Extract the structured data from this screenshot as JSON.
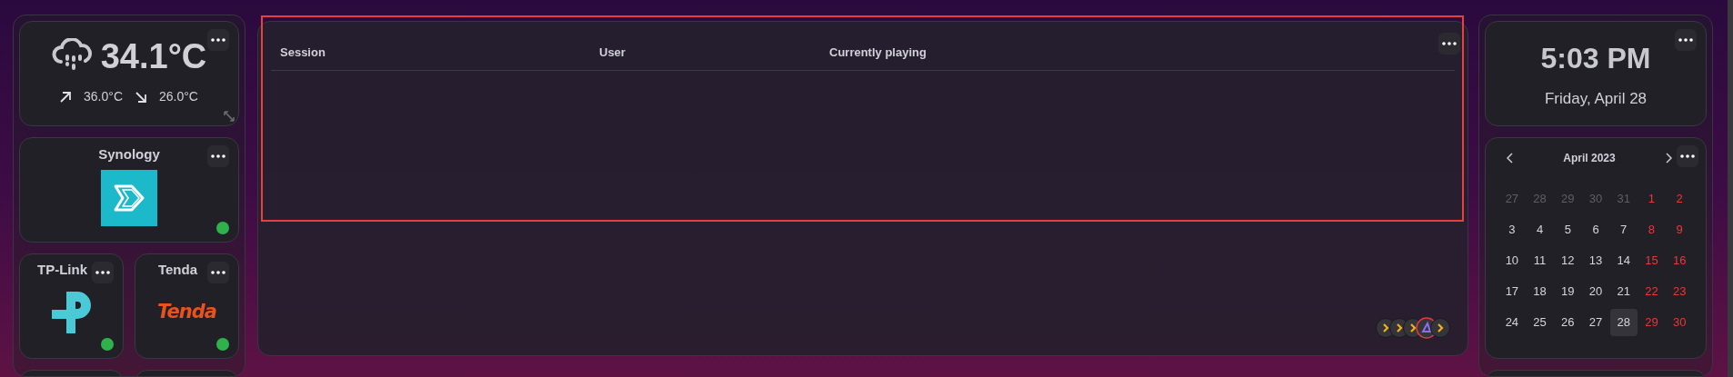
{
  "weather": {
    "temperature": "34.1°C",
    "high": "36.0°C",
    "low": "26.0°C"
  },
  "apps": [
    {
      "name": "Synology",
      "kind": "synology",
      "online": true
    },
    {
      "name": "TP-Link",
      "kind": "tplink",
      "online": true
    },
    {
      "name": "Tenda",
      "kind": "tenda",
      "logo_text": "Tenda",
      "online": true
    }
  ],
  "sessions": {
    "columns": [
      "Session",
      "User",
      "Currently playing"
    ],
    "avatars": [
      {
        "kind": "chevron"
      },
      {
        "kind": "chevron"
      },
      {
        "kind": "chevron"
      },
      {
        "kind": "ring"
      },
      {
        "kind": "chevron"
      }
    ]
  },
  "clock": {
    "time": "5:03 PM",
    "date": "Friday, April 28"
  },
  "calendar": {
    "month": "April 2023",
    "days": [
      {
        "label": "27",
        "kind": "outside",
        "selected": false
      },
      {
        "label": "28",
        "kind": "outside",
        "selected": false
      },
      {
        "label": "29",
        "kind": "outside",
        "selected": false
      },
      {
        "label": "30",
        "kind": "outside",
        "selected": false
      },
      {
        "label": "31",
        "kind": "outside",
        "selected": false
      },
      {
        "label": "1",
        "kind": "weekend",
        "selected": false
      },
      {
        "label": "2",
        "kind": "weekend",
        "selected": false
      },
      {
        "label": "3",
        "kind": "weekday",
        "selected": false
      },
      {
        "label": "4",
        "kind": "weekday",
        "selected": false
      },
      {
        "label": "5",
        "kind": "weekday",
        "selected": false
      },
      {
        "label": "6",
        "kind": "weekday",
        "selected": false
      },
      {
        "label": "7",
        "kind": "weekday",
        "selected": false
      },
      {
        "label": "8",
        "kind": "weekend",
        "selected": false
      },
      {
        "label": "9",
        "kind": "weekend",
        "selected": false
      },
      {
        "label": "10",
        "kind": "weekday",
        "selected": false
      },
      {
        "label": "11",
        "kind": "weekday",
        "selected": false
      },
      {
        "label": "12",
        "kind": "weekday",
        "selected": false
      },
      {
        "label": "13",
        "kind": "weekday",
        "selected": false
      },
      {
        "label": "14",
        "kind": "weekday",
        "selected": false
      },
      {
        "label": "15",
        "kind": "weekend",
        "selected": false
      },
      {
        "label": "16",
        "kind": "weekend",
        "selected": false
      },
      {
        "label": "17",
        "kind": "weekday",
        "selected": false
      },
      {
        "label": "18",
        "kind": "weekday",
        "selected": false
      },
      {
        "label": "19",
        "kind": "weekday",
        "selected": false
      },
      {
        "label": "20",
        "kind": "weekday",
        "selected": false
      },
      {
        "label": "21",
        "kind": "weekday",
        "selected": false
      },
      {
        "label": "22",
        "kind": "weekend",
        "selected": false
      },
      {
        "label": "23",
        "kind": "weekend",
        "selected": false
      },
      {
        "label": "24",
        "kind": "weekday",
        "selected": false
      },
      {
        "label": "25",
        "kind": "weekday",
        "selected": false
      },
      {
        "label": "26",
        "kind": "weekday",
        "selected": false
      },
      {
        "label": "27",
        "kind": "weekday",
        "selected": false
      },
      {
        "label": "28",
        "kind": "weekday",
        "selected": true
      },
      {
        "label": "29",
        "kind": "weekend",
        "selected": false
      },
      {
        "label": "30",
        "kind": "weekend",
        "selected": false
      }
    ]
  }
}
